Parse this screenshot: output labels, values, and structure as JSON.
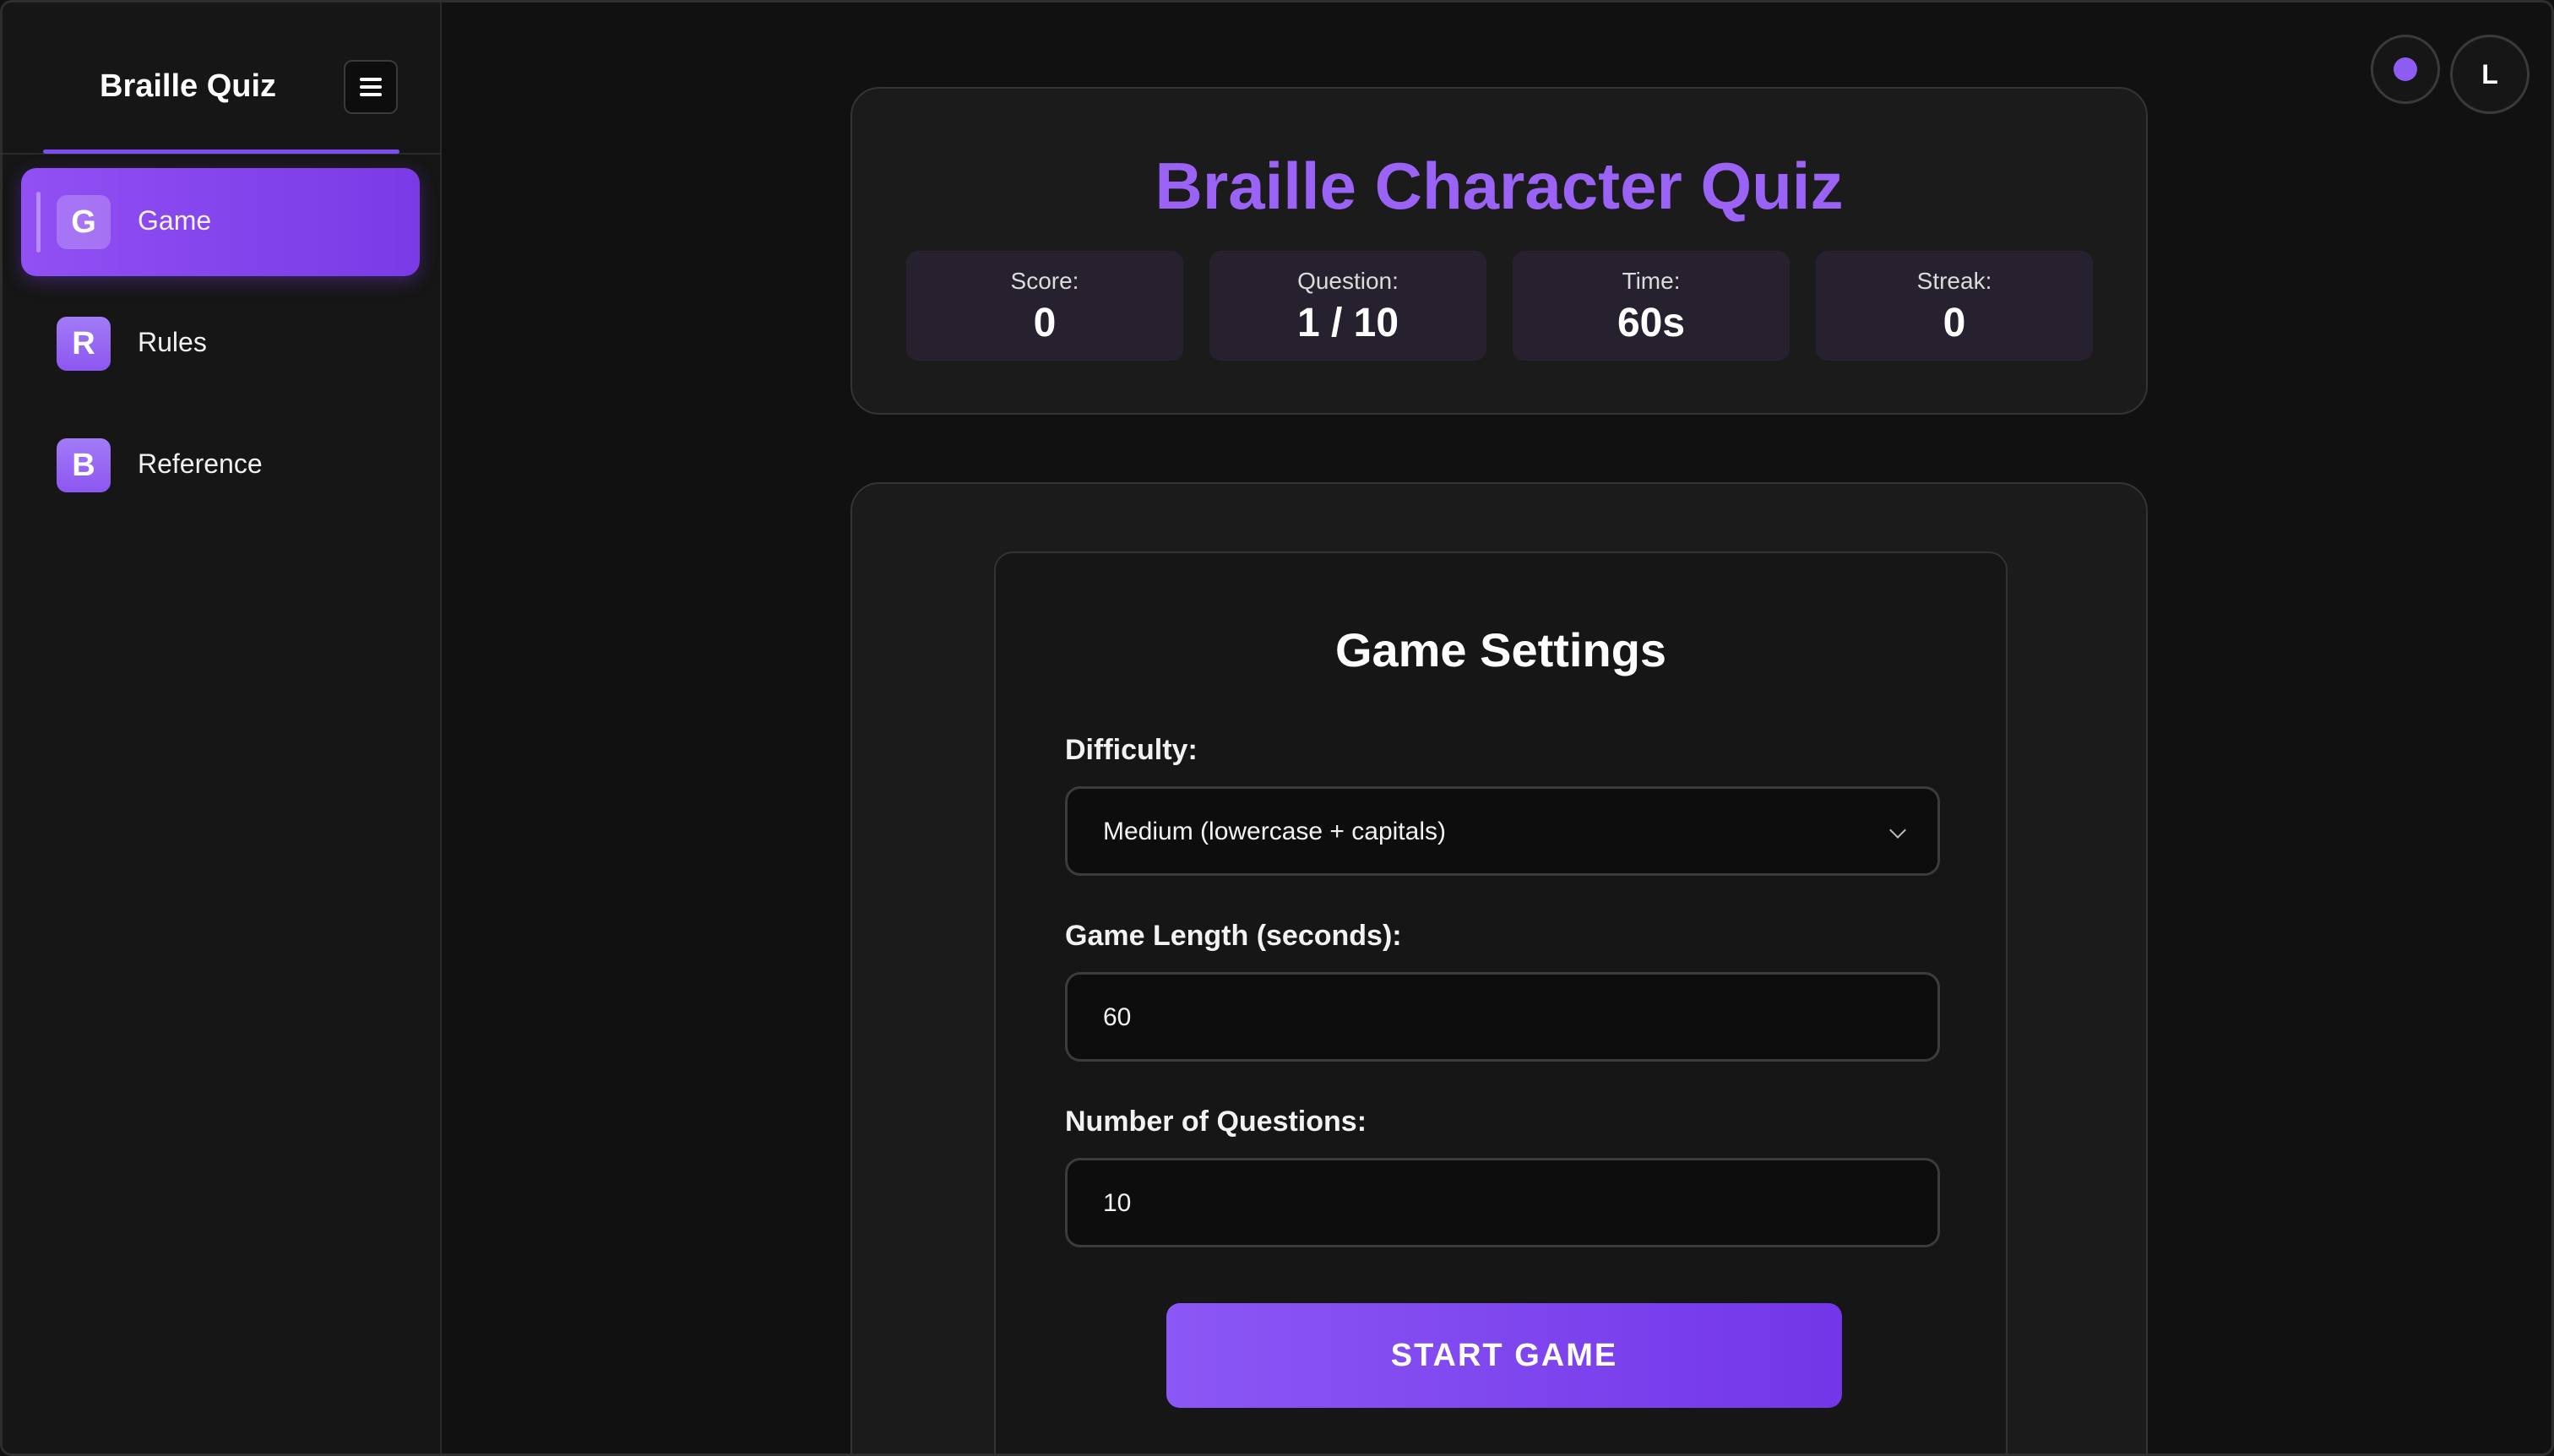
{
  "sidebar": {
    "brand": "Braille Quiz",
    "items": [
      {
        "icon_letter": "G",
        "label": "Game",
        "active": true
      },
      {
        "icon_letter": "R",
        "label": "Rules",
        "active": false
      },
      {
        "icon_letter": "B",
        "label": "Reference",
        "active": false
      }
    ]
  },
  "top_right": {
    "avatar_letter": "L"
  },
  "header": {
    "title": "Braille Character Quiz",
    "stats": [
      {
        "label": "Score:",
        "value": "0"
      },
      {
        "label": "Question:",
        "value": "1 / 10"
      },
      {
        "label": "Time:",
        "value": "60s"
      },
      {
        "label": "Streak:",
        "value": "0"
      }
    ]
  },
  "settings": {
    "title": "Game Settings",
    "difficulty_label": "Difficulty:",
    "difficulty_value": "Medium (lowercase + capitals)",
    "length_label": "Game Length (seconds):",
    "length_value": "60",
    "questions_label": "Number of Questions:",
    "questions_value": "10",
    "start_label": "START GAME"
  },
  "colors": {
    "accent": "#8b57f5",
    "title_accent": "#9a62f5",
    "background": "#111111",
    "card": "#1b1b1b",
    "stat_box": "#27212f"
  }
}
